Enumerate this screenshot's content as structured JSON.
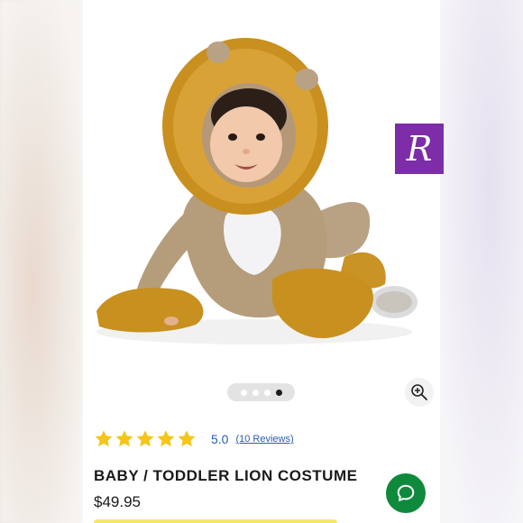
{
  "product": {
    "title": "BABY / TODDLER LION COSTUME",
    "price": "$49.95",
    "photo_alt_icon": "lion-costume-photo"
  },
  "gallery": {
    "total_images": 4,
    "active_index": 3
  },
  "rating": {
    "stars": 5,
    "score": "5.0",
    "reviews_label": "(10 Reviews)"
  },
  "badge": {
    "letter": "R"
  },
  "icons": {
    "zoom": "zoom-in-icon",
    "chat": "chat-icon",
    "star": "star-icon"
  },
  "colors": {
    "star": "#f5c518",
    "link": "#2a5db0",
    "chat_button": "#0f8a3c",
    "badge": "#7d2da8",
    "cta_bar": "#f5e56a"
  }
}
